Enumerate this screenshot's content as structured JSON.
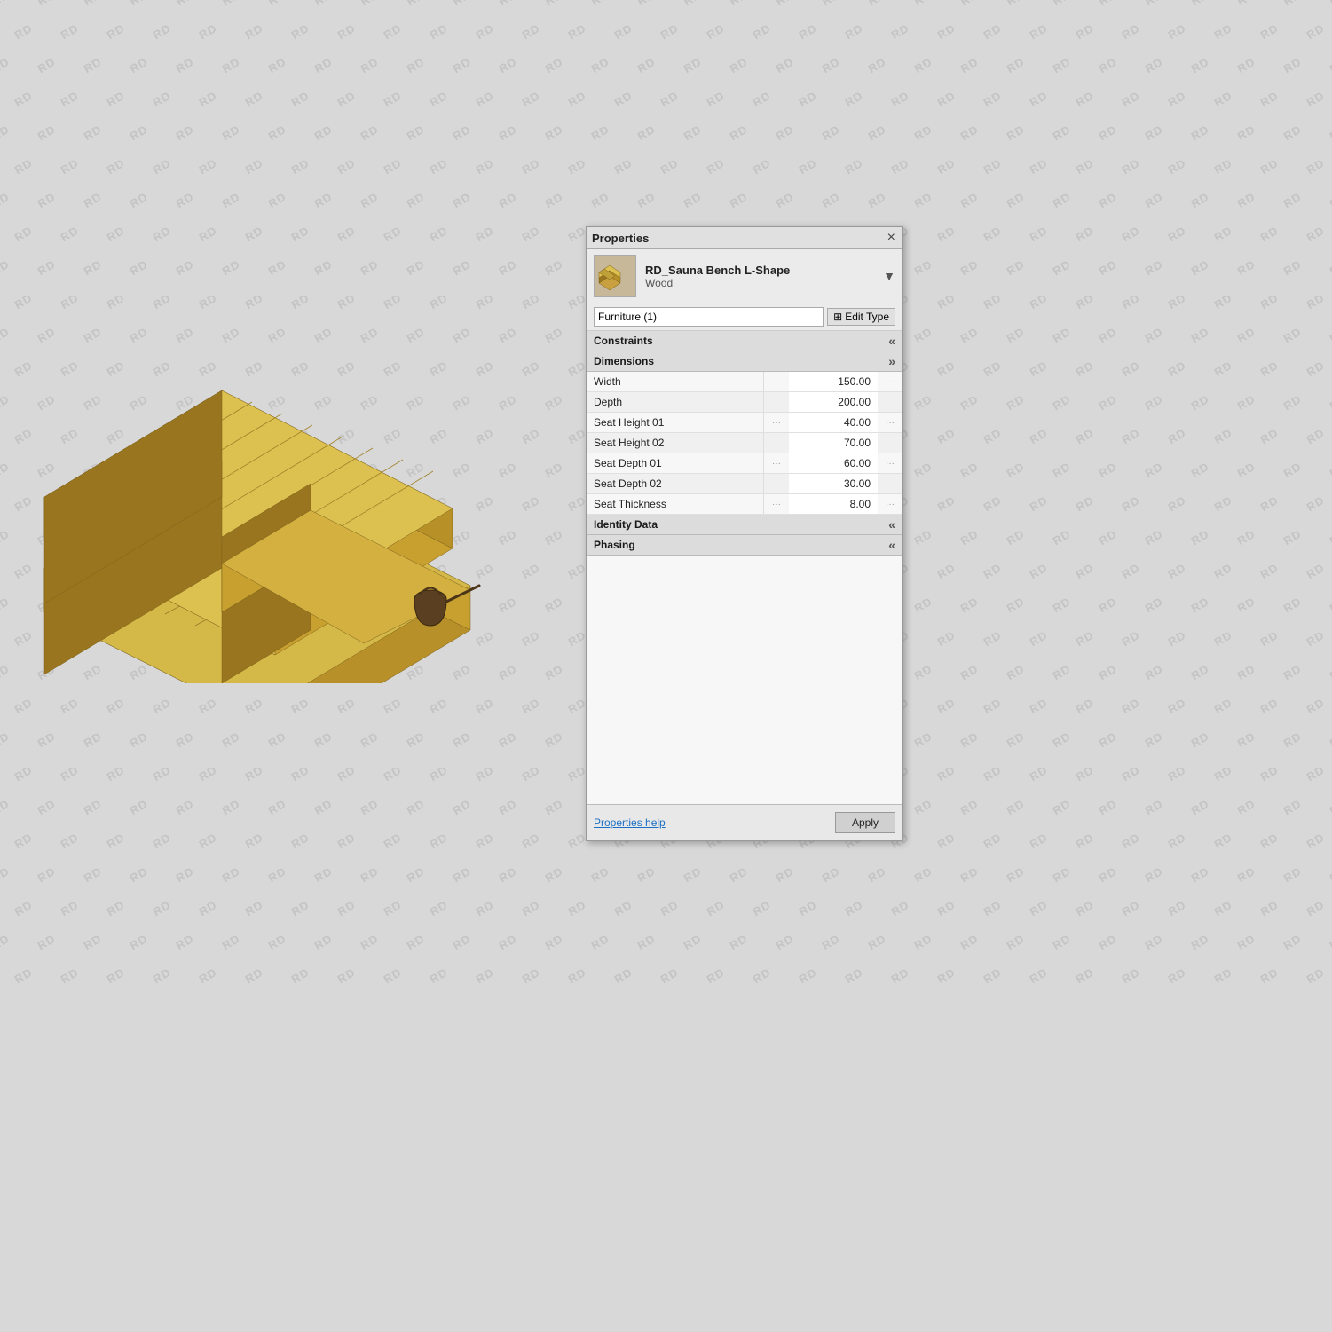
{
  "watermarks": [
    "RD"
  ],
  "panel": {
    "title": "Properties",
    "close_label": "×",
    "object": {
      "name": "RD_Sauna Bench L-Shape",
      "sub": "Wood",
      "thumb_alt": "bench-thumbnail"
    },
    "selector": {
      "value": "Furniture (1)",
      "options": [
        "Furniture (1)"
      ]
    },
    "edit_type_label": "Edit Type",
    "sections": {
      "constraints": {
        "label": "Constraints"
      },
      "dimensions": {
        "label": "Dimensions",
        "rows": [
          {
            "label": "Width",
            "value": "150.00"
          },
          {
            "label": "Depth",
            "value": "200.00"
          },
          {
            "label": "Seat Height 01",
            "value": "40.00"
          },
          {
            "label": "Seat Height 02",
            "value": "70.00"
          },
          {
            "label": "Seat Depth 01",
            "value": "60.00"
          },
          {
            "label": "Seat Depth 02",
            "value": "30.00"
          },
          {
            "label": "Seat Thickness",
            "value": "8.00"
          }
        ]
      },
      "identity_data": {
        "label": "Identity Data"
      },
      "phasing": {
        "label": "Phasing"
      }
    },
    "footer": {
      "help_link": "Properties help",
      "apply_label": "Apply"
    }
  },
  "icons": {
    "close": "✕",
    "dropdown_arrow": "▼",
    "edit_type_icon": "⊞",
    "collapse": "«",
    "expand": "»",
    "section_collapse": "«",
    "section_expand": "»"
  }
}
